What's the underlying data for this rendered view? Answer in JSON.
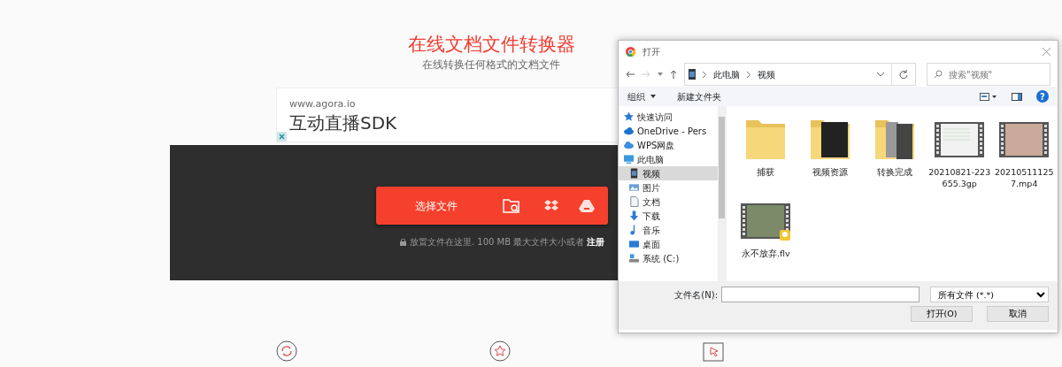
{
  "page": {
    "title": "在线文档文件转换器",
    "subtitle": "在线转换任何格式的文档文件",
    "ad": {
      "url": "www.agora.io",
      "headline": "互动直播SDK"
    },
    "upload": {
      "button": "选择文件",
      "hint": "放置文件在这里. 100 MB 最大文件大小或者",
      "link": "注册"
    },
    "features": [
      {
        "kind": "convert"
      },
      {
        "kind": "star"
      },
      {
        "kind": "cursor"
      }
    ]
  },
  "dialog": {
    "title": "打开",
    "breadcrumb": [
      "此电脑",
      "视频"
    ],
    "search": {
      "placeholder": "搜索\"视频\""
    },
    "toolbar": {
      "organize": "组织",
      "new_folder": "新建文件夹",
      "help": "?"
    },
    "sidebar": [
      {
        "label": "快速访问",
        "kind": "star",
        "selected": false
      },
      {
        "label": "OneDrive - Pers",
        "kind": "cloud",
        "selected": false
      },
      {
        "label": "WPS网盘",
        "kind": "wps",
        "selected": false
      },
      {
        "label": "此电脑",
        "kind": "pc",
        "selected": false,
        "children": [
          {
            "label": "视频",
            "kind": "video",
            "selected": true
          },
          {
            "label": "图片",
            "kind": "picture",
            "selected": false
          },
          {
            "label": "文档",
            "kind": "doc",
            "selected": false
          },
          {
            "label": "下载",
            "kind": "download",
            "selected": false
          },
          {
            "label": "音乐",
            "kind": "music",
            "selected": false
          },
          {
            "label": "桌面",
            "kind": "desktop",
            "selected": false
          },
          {
            "label": "系统 (C:)",
            "kind": "drive",
            "selected": false
          }
        ]
      }
    ],
    "files": [
      {
        "name": "捕获",
        "kind": "folder"
      },
      {
        "name": "视频资源",
        "kind": "folder-dark"
      },
      {
        "name": "转换完成",
        "kind": "folder-photo"
      },
      {
        "name": "20210821-223655.3gp",
        "kind": "video-screen"
      },
      {
        "name": "202105111257.mp4",
        "kind": "video"
      },
      {
        "name": "永不放弃.flv",
        "kind": "video-player"
      }
    ],
    "filename_label": "文件名(N):",
    "filter": "所有文件 (*.*)",
    "buttons": [
      "打开(O)",
      "取消"
    ]
  }
}
